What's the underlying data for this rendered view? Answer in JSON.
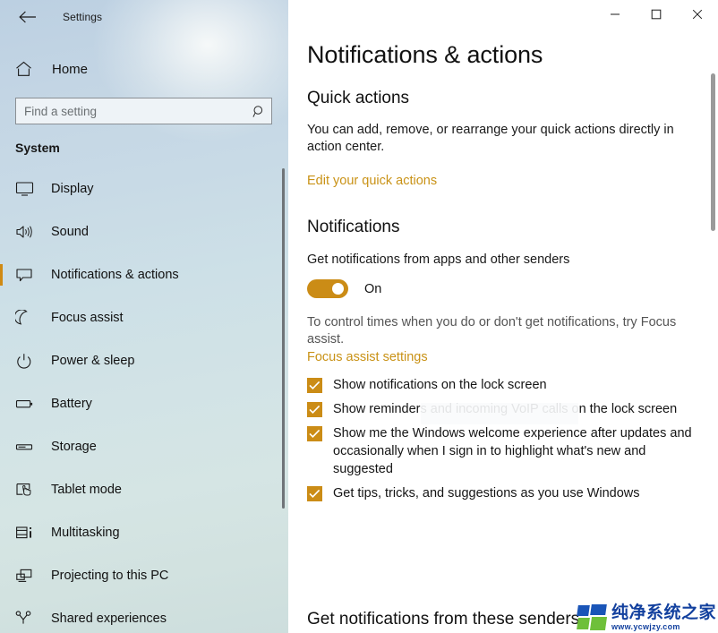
{
  "window": {
    "title": "Settings",
    "back_icon": "back-arrow-icon",
    "minimize_label": "Minimize",
    "maximize_label": "Maximize",
    "close_label": "Close"
  },
  "sidebar": {
    "home_label": "Home",
    "home_icon": "home-icon",
    "search": {
      "placeholder": "Find a setting",
      "value": "",
      "icon": "search-icon"
    },
    "section_label": "System",
    "accent_color": "#d08a14",
    "items": [
      {
        "label": "Display",
        "icon": "monitor-icon",
        "selected": false
      },
      {
        "label": "Sound",
        "icon": "speaker-icon",
        "selected": false
      },
      {
        "label": "Notifications & actions",
        "icon": "chat-bubble-icon",
        "selected": true
      },
      {
        "label": "Focus assist",
        "icon": "moon-icon",
        "selected": false
      },
      {
        "label": "Power & sleep",
        "icon": "power-icon",
        "selected": false
      },
      {
        "label": "Battery",
        "icon": "battery-icon",
        "selected": false
      },
      {
        "label": "Storage",
        "icon": "storage-icon",
        "selected": false
      },
      {
        "label": "Tablet mode",
        "icon": "tablet-touch-icon",
        "selected": false
      },
      {
        "label": "Multitasking",
        "icon": "multitasking-icon",
        "selected": false
      },
      {
        "label": "Projecting to this PC",
        "icon": "project-screen-icon",
        "selected": false
      },
      {
        "label": "Shared experiences",
        "icon": "shared-experiences-icon",
        "selected": false
      }
    ]
  },
  "main": {
    "page_title": "Notifications & actions",
    "quick_actions": {
      "heading": "Quick actions",
      "description": "You can add, remove, or rearrange your quick actions directly in action center.",
      "link": "Edit your quick actions"
    },
    "notifications": {
      "heading": "Notifications",
      "toggle_label": "Get notifications from apps and other senders",
      "toggle_state": "On",
      "toggle_color": "#cb8c16",
      "focus_note": "To control times when you do or don't get notifications, try Focus assist.",
      "focus_link": "Focus assist settings",
      "checkboxes": [
        {
          "label": "Show notifications on the lock screen",
          "checked": true
        },
        {
          "label": "Show reminders and incoming VoIP calls on the lock screen",
          "checked": true
        },
        {
          "label": "Show me the Windows welcome experience after updates and occasionally when I sign in to highlight what's new and suggested",
          "checked": true
        },
        {
          "label": "Get tips, tricks, and suggestions as you use Windows",
          "checked": true
        }
      ]
    },
    "bottom_heading": "Get notifications from these senders"
  },
  "watermark": {
    "cn_text": "纯净系统之家",
    "url": "www.ycwjzy.com",
    "blue": "#12409e",
    "green": "#6fc03a"
  }
}
